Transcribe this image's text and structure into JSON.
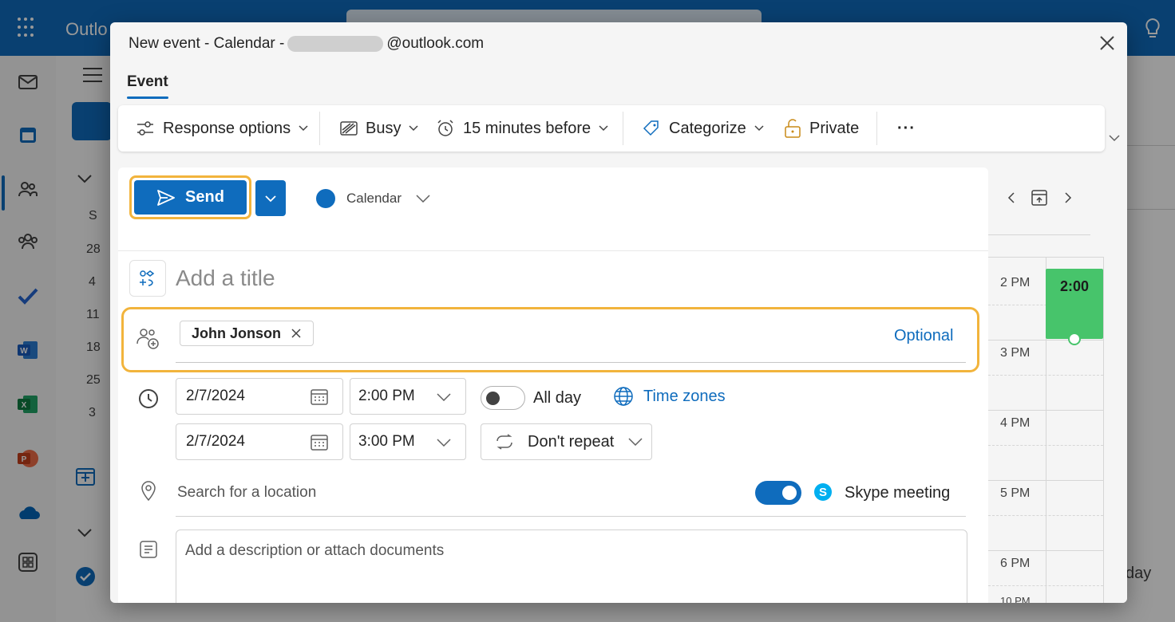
{
  "background": {
    "brand": "Outlo",
    "mini_calendar": {
      "weekday": "S",
      "dates": [
        "28",
        "4",
        "11",
        "18",
        "25",
        "3"
      ]
    },
    "day_label": "day"
  },
  "dialog": {
    "title_prefix": "New event - Calendar -",
    "title_suffix": "@outlook.com",
    "tab": "Event"
  },
  "ribbon": {
    "response_options": "Response options",
    "busy": "Busy",
    "reminder": "15 minutes before",
    "categorize": "Categorize",
    "private": "Private",
    "more": "···"
  },
  "send": {
    "label": "Send"
  },
  "calendar_picker": {
    "label": "Calendar"
  },
  "title": {
    "placeholder": "Add a title"
  },
  "attendees": {
    "chips": [
      {
        "name": "John Jonson"
      }
    ],
    "optional_label": "Optional"
  },
  "schedule": {
    "start_date": "2/7/2024",
    "start_time": "2:00 PM",
    "end_date": "2/7/2024",
    "end_time": "3:00 PM",
    "all_day_label": "All day",
    "all_day": false,
    "time_zones_label": "Time zones",
    "repeat_label": "Don't repeat"
  },
  "location": {
    "placeholder": "Search for a location"
  },
  "skype": {
    "label": "Skype meeting",
    "enabled": true
  },
  "description": {
    "placeholder": "Add a description or attach documents"
  },
  "preview": {
    "times": [
      "2 PM",
      "3 PM",
      "4 PM",
      "5 PM",
      "6 PM",
      "10 PM"
    ],
    "event_time": "2:00"
  },
  "colors": {
    "accent": "#0f6cbd",
    "highlight": "#f2b43c",
    "event": "#47c46b"
  }
}
